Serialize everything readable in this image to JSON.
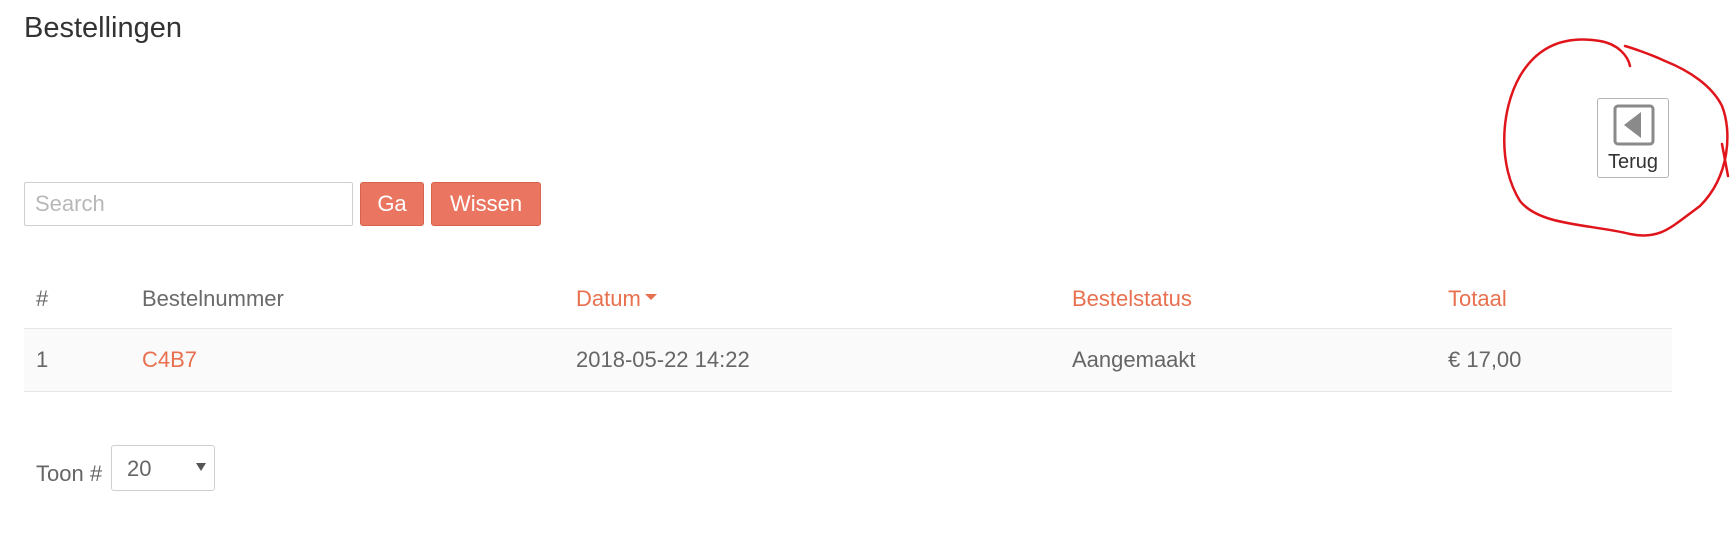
{
  "page": {
    "title": "Bestellingen"
  },
  "back_button": {
    "label": "Terug",
    "icon": "caret-left-square-icon"
  },
  "search": {
    "placeholder": "Search",
    "value": "",
    "go_label": "Ga",
    "clear_label": "Wissen"
  },
  "table": {
    "headers": {
      "num": "#",
      "order_number": "Bestelnummer",
      "date": "Datum",
      "status": "Bestelstatus",
      "total": "Totaal"
    },
    "sorted_column": "Datum",
    "sort_direction": "descending",
    "rows": [
      {
        "num": "1",
        "order_number": "C4B7",
        "date": "2018-05-22 14:22",
        "status": "Aangemaakt",
        "total": "€ 17,00"
      }
    ]
  },
  "pager": {
    "label": "Toon #",
    "selected": "20"
  },
  "colors": {
    "accent": "#ea7560",
    "link": "#e8704f",
    "annotation": "#e0151c"
  }
}
